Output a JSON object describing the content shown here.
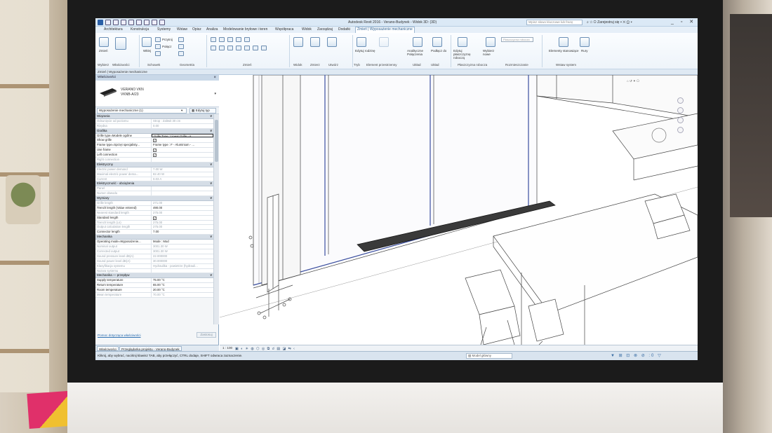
{
  "titlebar": {
    "title": "Autodesk Revit 2016 - Verano-Budynek - Widok 3D: (3D)",
    "search_placeholder": "Wpisz słowo kluczowe lub frazę",
    "sign_in": "Zarejestruj się"
  },
  "ribbon_tabs": [
    "Architektura",
    "Konstrukcja",
    "Systemy",
    "Wstaw",
    "Opisz",
    "Analiza",
    "Modelowanie bryłowe i teren",
    "Współpraca",
    "Widok",
    "Zarządzaj",
    "Dodatki",
    "Zmień | Wyposażenie mechaniczne"
  ],
  "ribbon_panels": {
    "select": "Wybierz",
    "properties": "Właściwości",
    "clipboard": "Schowek",
    "geometry": "Geometria",
    "modify": "Zmień",
    "view": "Widok",
    "measure": "Zmierz",
    "create": "Utwórz",
    "mode": "Tryb",
    "family_element": "Element przestrzenny",
    "layout": "Układ",
    "analytical": "Układ",
    "workplane": "Płaszczyzna robocza",
    "placement": "Rozmieszczanie",
    "host_elements": "Wstaw system"
  },
  "ribbon_buttons": {
    "modify": "Zmień",
    "paste": "Wklej",
    "cut": "Przytnij",
    "join": "Połącz",
    "edit_family": "Edytuj rodzinę",
    "edit_family_line2": "",
    "analytical_connections": "Analityczne Połączenia",
    "connect_into": "Podłącz do",
    "edit_workplane": "Edytuj płaszczyznę roboczą",
    "pick_new": "Wybierz nowe",
    "workplane_field": "Płaszczyzna robocza",
    "system_elements": "Elementy stanowiące",
    "duct": "Rury"
  },
  "context_bar": "Zmień | Wyposażenie mechaniczne",
  "properties": {
    "header": "Właściwości",
    "type_name_1": "VERANO VKN",
    "type_name_2": "VKNB-A/23",
    "instance_selector": "Wyposażenie mechaniczne (1)",
    "edit_type": "Edytuj typ",
    "help_link": "Pomoc dotycząca właściwości",
    "apply": "Zastosuj",
    "groups": [
      {
        "name": "Wiązania",
        "rows": [
          {
            "n": "Odsunięcie od poziomu",
            "v": "Strop : Zaltwit 30 cm",
            "dim": true
          },
          {
            "n": "Rzędna",
            "v": "0.00",
            "dim": true
          }
        ]
      },
      {
        "name": "Grafika",
        "rows": [
          {
            "n": "Grille type=Modele ogólne",
            "v": "Grille Type : Linear Grille - A...",
            "sel": true
          },
          {
            "n": "Show grille",
            "v": "",
            "cb": true
          },
          {
            "n": "Frame type=Sprzęt specjalisty...",
            "v": "Frame type : F - Aluminium - ..."
          },
          {
            "n": "Use frame",
            "v": "",
            "cb": true
          },
          {
            "n": "Left connection",
            "v": "",
            "cb": true
          },
          {
            "n": "Right connection",
            "v": "",
            "dim": true
          }
        ]
      },
      {
        "name": "Elektryczny",
        "rows": [
          {
            "n": "Electric power demand",
            "v": "7.00 W",
            "dim": true
          },
          {
            "n": "Maximal electric power dema...",
            "v": "82.40 W",
            "dim": true
          },
          {
            "n": "Current",
            "v": "0.03 A",
            "dim": true
          }
        ]
      },
      {
        "name": "Elektryczność - obciążenia",
        "rows": [
          {
            "n": "Panel",
            "v": "",
            "dim": true
          },
          {
            "n": "Numer obwodu",
            "v": "",
            "dim": true
          }
        ]
      },
      {
        "name": "Wymiary",
        "rows": [
          {
            "n": "Grille length",
            "v": "271.00",
            "dim": true
          },
          {
            "n": "Trench length (Value entered)",
            "v": "490.00"
          },
          {
            "n": "Nearest standard length",
            "v": "275.00",
            "dim": true
          },
          {
            "n": "Standard length",
            "v": "",
            "cb": true
          },
          {
            "n": "Trench length (Ls)",
            "v": "275.00",
            "dim": true
          },
          {
            "n": "Output calculation length",
            "v": "275.00",
            "dim": true
          },
          {
            "n": "Connector length",
            "v": "7.00"
          }
        ]
      },
      {
        "name": "Mechanika",
        "rows": [
          {
            "n": "Operating mode=Wyposażenie...",
            "v": "Mode : Mod"
          },
          {
            "n": "Nominal output",
            "v": "3001.30 W",
            "dim": true
          },
          {
            "n": "Corrected output",
            "v": "3001.30 W",
            "dim": true
          },
          {
            "n": "Sound pressure level dB(A)",
            "v": "22.000000",
            "dim": true
          },
          {
            "n": "Sound power level dB(A)",
            "v": "30.000000",
            "dim": true
          },
          {
            "n": "Klasyfikacja systemu",
            "v": "Hydraulika - powietrze (hydrauli...",
            "dim": true
          },
          {
            "n": "Nazwa systemu",
            "v": "",
            "dim": true
          }
        ]
      },
      {
        "name": "Mechanika — przepływ",
        "rows": [
          {
            "n": "Supply temperature",
            "v": "75.00 °C"
          },
          {
            "n": "Return temperature",
            "v": "65.00 °C"
          },
          {
            "n": "Room temperature",
            "v": "20.00 °C"
          },
          {
            "n": "Mean temperature",
            "v": "70.00 °C",
            "dim": true
          }
        ]
      }
    ]
  },
  "bottom_tabs": [
    "Właściwości",
    "Przeglądarka projektu - Verano-Budynek"
  ],
  "view_control": {
    "scale": "1 : 100"
  },
  "statusbar": {
    "text": "Kliknij, aby wybrać, naciśnij klawisz TAB, aby przełączyć, CTRL dodaje, SHIFT odwraca zaznaczenie.",
    "model": "Model główny",
    "count": ":0"
  },
  "colors": {
    "ribbon_accent": "#2a5d8f",
    "titlebar": "#dbe9f6",
    "bezel": "#1b1b1b"
  }
}
